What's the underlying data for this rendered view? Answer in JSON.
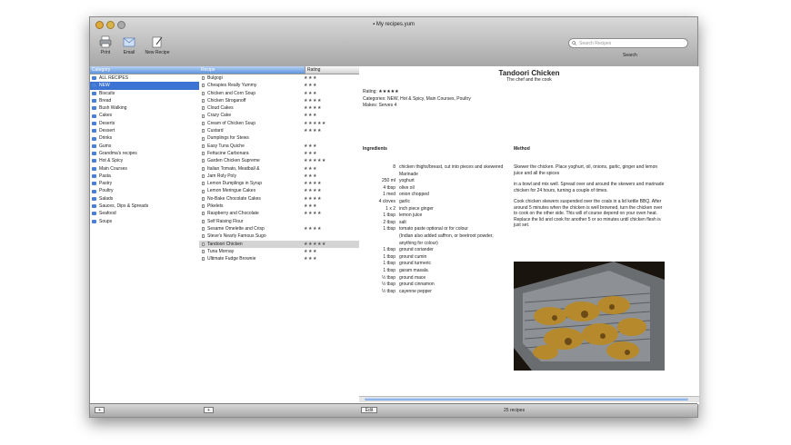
{
  "window": {
    "title": "My recipes.yum"
  },
  "toolbar": {
    "print_label": "Print",
    "email_label": "Email",
    "new_recipe_label": "New Recipe",
    "search_placeholder": "Search Recipes",
    "search_label": "Search"
  },
  "categories": {
    "header": "Category",
    "items": [
      {
        "label": "ALL RECIPES"
      },
      {
        "label": "NEW"
      },
      {
        "label": "Biscuits"
      },
      {
        "label": "Bread"
      },
      {
        "label": "Bush Walking"
      },
      {
        "label": "Cakes"
      },
      {
        "label": "Deserts"
      },
      {
        "label": "Dessert"
      },
      {
        "label": "Drinks"
      },
      {
        "label": "Gums"
      },
      {
        "label": "Grandma's recipes"
      },
      {
        "label": "Hot & Spicy"
      },
      {
        "label": "Main Courses"
      },
      {
        "label": "Pasta"
      },
      {
        "label": "Pastry"
      },
      {
        "label": "Poultry"
      },
      {
        "label": "Salads"
      },
      {
        "label": "Sauces, Dips & Spreads"
      },
      {
        "label": "Seafood"
      },
      {
        "label": "Soups"
      }
    ]
  },
  "recipes": {
    "header_name": "Recipe",
    "header_rating": "Rating",
    "items": [
      {
        "name": "Bulgogi",
        "rating": "★★★"
      },
      {
        "name": "Cheapies Really Yummy",
        "rating": "★★★"
      },
      {
        "name": "Chicken and Corn Soup",
        "rating": "★★★"
      },
      {
        "name": "Chicken Stroganoff",
        "rating": "★★★★"
      },
      {
        "name": "Cloud Cakes",
        "rating": "★★★★"
      },
      {
        "name": "Crazy Cake",
        "rating": "★★★"
      },
      {
        "name": "Cream of Chicken Soup",
        "rating": "★★★★★"
      },
      {
        "name": "Custard",
        "rating": "★★★★"
      },
      {
        "name": "Dumplings for Stews",
        "rating": ""
      },
      {
        "name": "Easy Tuna Quiche",
        "rating": "★★★"
      },
      {
        "name": "Fettucine Carbonara",
        "rating": "★★★"
      },
      {
        "name": "Garden Chicken Supreme",
        "rating": "★★★★★"
      },
      {
        "name": "Italian Tomato, Meatball &",
        "rating": "★★★"
      },
      {
        "name": "Jam Roly Poly",
        "rating": "★★★"
      },
      {
        "name": "Lemon Dumplings in Syrup",
        "rating": "★★★★"
      },
      {
        "name": "Lemon Meringue Cakes",
        "rating": "★★★★"
      },
      {
        "name": "No-Bake Chocolate Cakes",
        "rating": "★★★★"
      },
      {
        "name": "Pikelets",
        "rating": "★★★"
      },
      {
        "name": "Raspberry and Chocolate",
        "rating": "★★★★"
      },
      {
        "name": "Self Raising Flour",
        "rating": ""
      },
      {
        "name": "Sesame Omelette and Crisp",
        "rating": "★★★★"
      },
      {
        "name": "Steve's Nearly Famous Sugo",
        "rating": ""
      },
      {
        "name": "Tandoori Chicken",
        "rating": "★★★★★"
      },
      {
        "name": "Tuna Mornay",
        "rating": "★★★"
      },
      {
        "name": "Ultimate Fudge Brownie",
        "rating": "★★★"
      }
    ]
  },
  "detail": {
    "title": "Tandoori Chicken",
    "subtitle": "The chef and the cook",
    "rating_label": "Rating:",
    "rating_stars": "★★★★★",
    "categories_line": "Categories: NEW, Hot & Spicy, Main Courses, Poultry",
    "makes_line": "Makes: Serves 4",
    "ingredients_header": "Ingredients",
    "method_header": "Method",
    "ingredients": [
      {
        "qty": "8",
        "text": "chicken thighs/breast, cut into pieces and skewered"
      },
      {
        "qty": "",
        "text": "Marinade"
      },
      {
        "qty": "250 ml",
        "text": "yoghurt"
      },
      {
        "qty": "4 tbsp",
        "text": "olive oil"
      },
      {
        "qty": "1 med",
        "text": "onion chopped"
      },
      {
        "qty": "4 cloves",
        "text": "garlic"
      },
      {
        "qty": "1 x 2",
        "text": "inch piece ginger"
      },
      {
        "qty": "1 tbsp",
        "text": "lemon juice"
      },
      {
        "qty": "2 tbsp",
        "text": "salt"
      },
      {
        "qty": "1 tbsp",
        "text": "tomato paste optional or for colour"
      },
      {
        "qty": "",
        "text": "(Indian also added saffron, or beetroot powder, anything for colour)"
      },
      {
        "qty": "1 tbsp",
        "text": "ground coriander"
      },
      {
        "qty": "1 tbsp",
        "text": "ground cumin"
      },
      {
        "qty": "1 tbsp",
        "text": "ground turmeric"
      },
      {
        "qty": "1 tbsp",
        "text": "garam masala"
      },
      {
        "qty": "½ tbsp",
        "text": "ground mace"
      },
      {
        "qty": "½ tbsp",
        "text": "ground cinnamon"
      },
      {
        "qty": "½ tbsp",
        "text": "cayenne pepper"
      }
    ],
    "method": [
      "Skewer the chicken. Place yoghurt, oil, onions, garlic, ginger and lemon juice and all the spices",
      "in a bowl and mix well. Spread over and around the skewers and marinade chicken for 24 hours, turning a couple of times.",
      "Cook chicken skewers suspended over the coals in a lid kettle BBQ. After around 5 minutes when the chicken is well browned, turn the chicken over to cook on the other side. This will of course depend on your oven heat. Replace the lid and cook for another 5 or so minutes until chicken flesh is just set."
    ]
  },
  "status": {
    "count": "25 recipes",
    "edit_label": "Edit"
  },
  "colors": {
    "selection": "#3d74d4",
    "accent": "#4a7fd6"
  }
}
